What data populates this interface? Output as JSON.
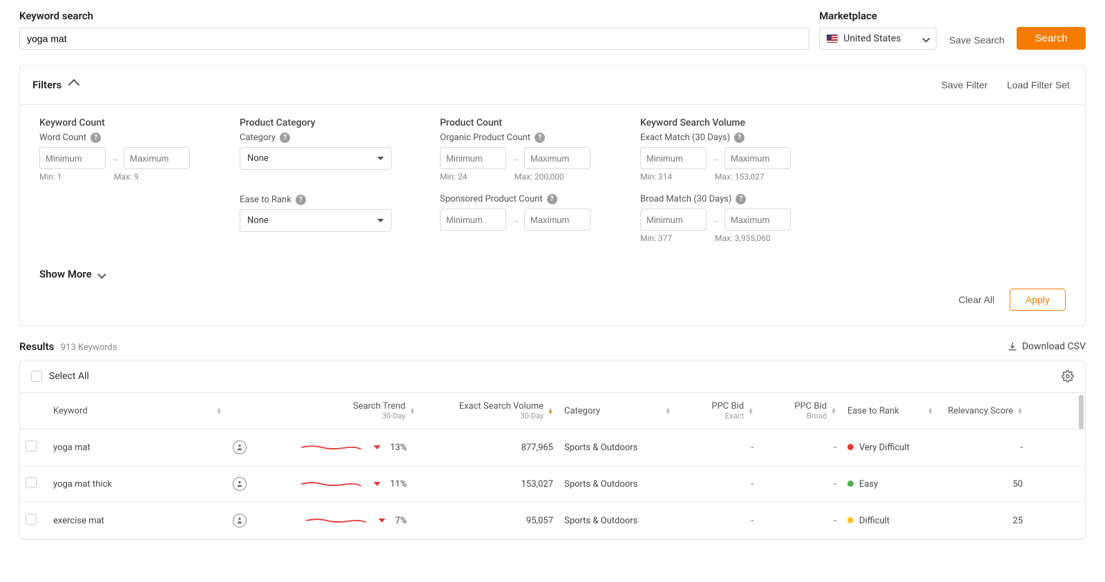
{
  "search": {
    "label": "Keyword search",
    "value": "yoga mat",
    "marketplace_label": "Marketplace",
    "marketplace_value": "United States",
    "save_search": "Save Search",
    "search_btn": "Search"
  },
  "filters": {
    "title": "Filters",
    "save_filter": "Save Filter",
    "load_filter": "Load Filter Set",
    "show_more": "Show More",
    "clear_all": "Clear All",
    "apply": "Apply",
    "ph_min": "Minimum",
    "ph_max": "Maximum",
    "groups": {
      "keyword_count": {
        "title": "Keyword Count",
        "word_count": "Word Count",
        "min_hint": "Min: 1",
        "max_hint": "Max: 9"
      },
      "product_category": {
        "title": "Product Category",
        "category": "Category",
        "category_value": "None",
        "ease_to_rank": "Ease to Rank",
        "ease_value": "None"
      },
      "product_count": {
        "title": "Product Count",
        "organic": "Organic Product Count",
        "organic_min": "Min: 24",
        "organic_max": "Max: 200,000",
        "sponsored": "Sponsored Product Count"
      },
      "search_volume": {
        "title": "Keyword Search Volume",
        "exact": "Exact Match (30 Days)",
        "exact_min": "Min: 314",
        "exact_max": "Max: 153,027",
        "broad": "Broad Match (30 Days)",
        "broad_min": "Min: 377",
        "broad_max": "Max: 3,955,060"
      }
    }
  },
  "results": {
    "title": "Results",
    "count": "913 Keywords",
    "download": "Download CSV",
    "select_all": "Select All",
    "columns": {
      "keyword": "Keyword",
      "search_trend": "Search Trend",
      "search_trend_sub": "30-Day",
      "exact_vol": "Exact Search Volume",
      "exact_vol_sub": "30-Day",
      "category": "Category",
      "ppc_exact": "PPC Bid",
      "ppc_exact_sub": "Exact",
      "ppc_broad": "PPC Bid",
      "ppc_broad_sub": "Broad",
      "ease": "Ease to Rank",
      "relevancy": "Relevancy Score"
    },
    "rows": [
      {
        "keyword": "yoga mat",
        "trend_pct": "13%",
        "volume": "877,965",
        "category": "Sports & Outdoors",
        "ppc_exact": "-",
        "ppc_broad": "-",
        "ease": "Very Difficult",
        "ease_color": "red",
        "relevancy": "-"
      },
      {
        "keyword": "yoga mat thick",
        "trend_pct": "11%",
        "volume": "153,027",
        "category": "Sports & Outdoors",
        "ppc_exact": "-",
        "ppc_broad": "-",
        "ease": "Easy",
        "ease_color": "green",
        "relevancy": "50"
      },
      {
        "keyword": "exercise mat",
        "trend_pct": "7%",
        "volume": "95,057",
        "category": "Sports & Outdoors",
        "ppc_exact": "-",
        "ppc_broad": "-",
        "ease": "Difficult",
        "ease_color": "yellow",
        "relevancy": "25"
      }
    ]
  }
}
